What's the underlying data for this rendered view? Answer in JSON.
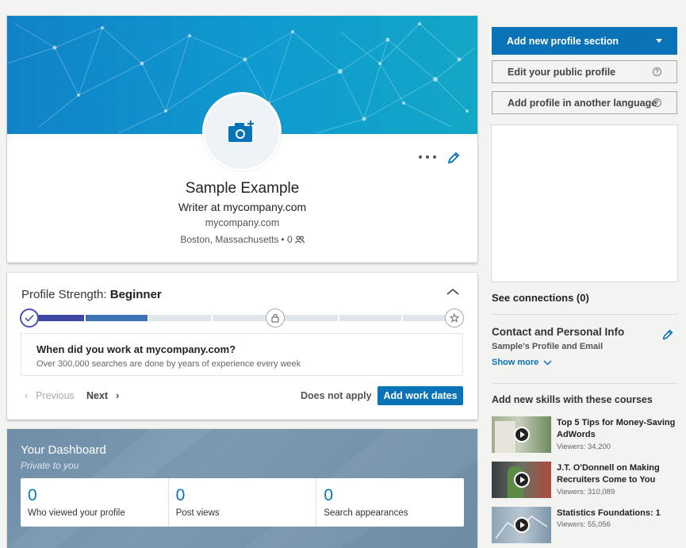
{
  "profile": {
    "name": "Sample Example",
    "headline": "Writer at mycompany.com",
    "company": "mycompany.com",
    "location": "Boston, Massachusetts",
    "connections_count": "• 0"
  },
  "strength": {
    "label": "Profile Strength:",
    "level": "Beginner",
    "completed_segments": 2,
    "total_segments": 7,
    "question_title": "When did you work at mycompany.com?",
    "question_sub": "Over 300,000 searches are done by years of experience every week",
    "previous_label": "Previous",
    "next_label": "Next",
    "does_not_apply_label": "Does not apply",
    "add_work_dates_label": "Add work dates",
    "colors": {
      "segment_1": "#3e48a4",
      "segment_2": "#3d72b5",
      "segment_empty": "#e1e6ea"
    }
  },
  "dashboard": {
    "title": "Your Dashboard",
    "subtitle": "Private to you",
    "stats": [
      {
        "value": "0",
        "label": "Who viewed your profile"
      },
      {
        "value": "0",
        "label": "Post views"
      },
      {
        "value": "0",
        "label": "Search appearances"
      }
    ]
  },
  "sidebar": {
    "add_section_label": "Add new profile section",
    "edit_public_profile_label": "Edit your public profile",
    "add_language_label": "Add profile in another language",
    "see_connections_label": "See connections (0)",
    "contact_title": "Contact and Personal Info",
    "contact_sub": "Sample's Profile and Email",
    "show_more_label": "Show more",
    "courses_title": "Add new skills with these courses",
    "courses": [
      {
        "title": "Top 5 Tips for Money-Saving AdWords",
        "viewers": "Viewers: 34,200"
      },
      {
        "title": "J.T. O'Donnell on Making Recruiters Come to You",
        "viewers": "Viewers: 310,089"
      },
      {
        "title": "Statistics Foundations: 1",
        "viewers": "Viewers: 55,056"
      }
    ]
  },
  "icons": {
    "camera": "camera-plus-icon",
    "more": "more-horizontal-icon",
    "edit": "pencil-icon",
    "connections": "people-icon",
    "collapse": "chevron-up-icon",
    "lock": "lock-icon",
    "star": "star-icon",
    "check": "check-icon",
    "help": "help-circle-icon",
    "play": "play-icon"
  },
  "colors": {
    "accent": "#0a73b8",
    "banner": "#0f9bd0"
  }
}
